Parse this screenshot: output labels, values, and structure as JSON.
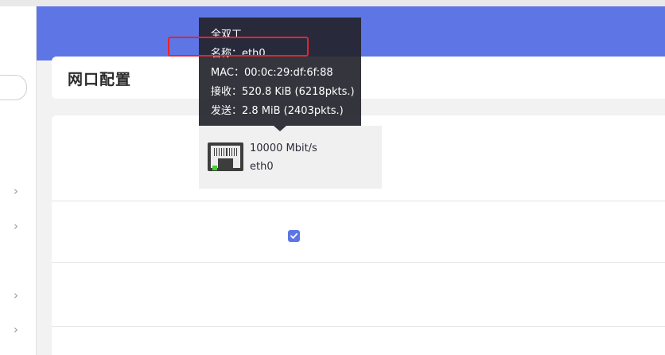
{
  "page": {
    "title": "网口配置"
  },
  "interface": {
    "speed": "10000 Mbit/s",
    "name": "eth0",
    "enabled": true
  },
  "tooltip": {
    "duplex": "全双工",
    "name_line": "名称：eth0",
    "mac_line": "MAC：00:0c:29:df:6f:88",
    "rx_line": "接收：520.8 KiB (6218pkts.)",
    "tx_line": "发送：2.8 MiB (2403pkts.)"
  },
  "colors": {
    "accent": "#5e76e5",
    "highlight": "#e8232a",
    "link_led": "#44d02c"
  },
  "icons": {
    "port": "ethernet-port-icon",
    "chevron": "chevron-right-icon",
    "check": "checkmark-icon"
  }
}
